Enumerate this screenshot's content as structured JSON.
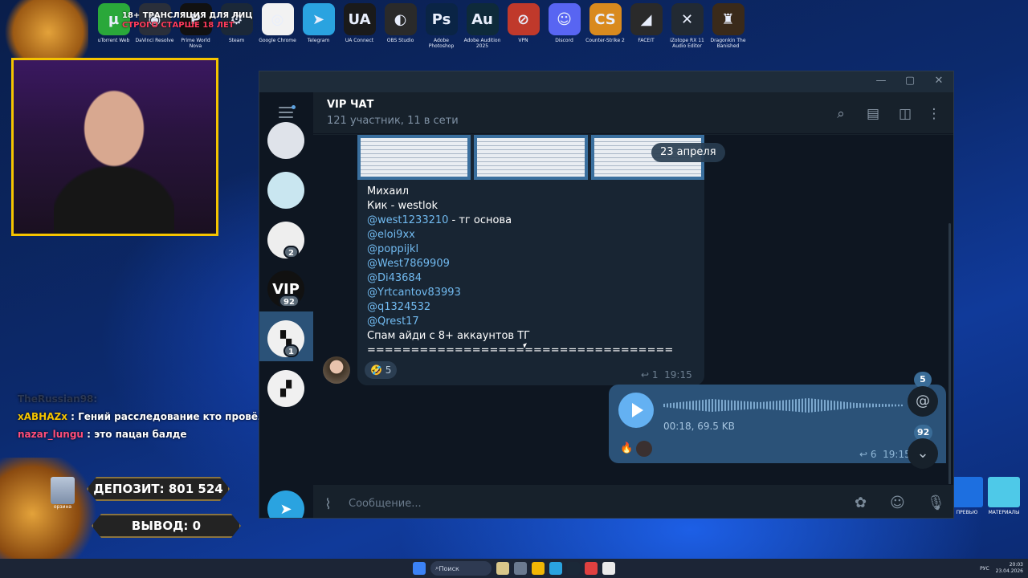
{
  "desktop": {
    "stream_title": [
      "ТРАНСЛЯЦИЯ ДЛЯ ЛИЦ",
      "СТРОГО СТАРШЕ 18 ЛЕТ"
    ],
    "age_rating": "18+",
    "icons": [
      {
        "label": "uTorrent Web",
        "icon": "utorrent-icon",
        "color": "#2aa83a",
        "glyph": "µ"
      },
      {
        "label": "DaVinci Resolve",
        "icon": "davinci-icon",
        "color": "#2a2f3a",
        "glyph": "◉"
      },
      {
        "label": "Prime World Nova",
        "icon": "prime-world-icon",
        "color": "#111111",
        "glyph": "P"
      },
      {
        "label": "Steam",
        "icon": "steam-icon",
        "color": "#1b2838",
        "glyph": "⚙"
      },
      {
        "label": "Google Chrome",
        "icon": "chrome-icon",
        "color": "#f2f2f2",
        "glyph": "◎"
      },
      {
        "label": "Telegram",
        "icon": "telegram-icon",
        "color": "#2aa3e0",
        "glyph": "➤"
      },
      {
        "label": "UA Connect",
        "icon": "ua-connect-icon",
        "color": "#1a1a1a",
        "glyph": "UA"
      },
      {
        "label": "OBS Studio",
        "icon": "obs-icon",
        "color": "#2a2a2a",
        "glyph": "◐"
      },
      {
        "label": "Adobe Photoshop",
        "icon": "photoshop-icon",
        "color": "#0a2445",
        "glyph": "Ps"
      },
      {
        "label": "Adobe Audition 2025",
        "icon": "audition-icon",
        "color": "#0e2a3a",
        "glyph": "Au"
      },
      {
        "label": "VPN",
        "icon": "vpn-icon",
        "color": "#c0392b",
        "glyph": "⊘"
      },
      {
        "label": "Discord",
        "icon": "discord-icon",
        "color": "#5865f2",
        "glyph": "☺"
      },
      {
        "label": "Counter-Strike 2",
        "icon": "cs2-icon",
        "color": "#d98a1e",
        "glyph": "CS"
      },
      {
        "label": "FACEIT",
        "icon": "faceit-icon",
        "color": "#2a2a2a",
        "glyph": "◢"
      },
      {
        "label": "iZotope RX 11 Audio Editor",
        "icon": "izotope-icon",
        "color": "#222a33",
        "glyph": "✕"
      },
      {
        "label": "Dragonkin The Banished",
        "icon": "dragonkin-icon",
        "color": "#3a2a1a",
        "glyph": "♜"
      }
    ],
    "partial_icons": [
      "Topaz Gigapixel AI"
    ],
    "bottom_icons": [
      {
        "label": "ПРЕВЬЮ",
        "color": "#1d6fe0"
      },
      {
        "label": "МАТЕРИАЛЫ",
        "color": "#4ec9e8"
      }
    ],
    "recycle_label": "орзина"
  },
  "stream_chat": {
    "faded": "TheRussian98:",
    "messages": [
      {
        "user": "xABHAZx",
        "text": " : Гений расследование кто провёл"
      },
      {
        "user": "nazar_lungu",
        "text": " : это пацан балде"
      }
    ]
  },
  "overlay": {
    "deposit": "ДЕПОЗИТ:  801 524",
    "withdraw": "ВЫВОД:  0"
  },
  "telegram": {
    "chat_title": "VIP ЧАТ",
    "chat_subtitle": "121 участник, 11 в сети",
    "date_pill": "23 апреля",
    "sidebar": [
      {
        "name": "avatar-1",
        "color": "#dfe3ea",
        "text": "",
        "badge": ""
      },
      {
        "name": "avatar-2",
        "color": "#c9e6f0",
        "text": "",
        "badge": ""
      },
      {
        "name": "avatar-3",
        "color": "#eeeeee",
        "text": "",
        "badge": "2"
      },
      {
        "name": "avatar-vip",
        "color": "#111111",
        "text": "VIP",
        "badge": "92"
      },
      {
        "name": "avatar-5",
        "color": "#f0f0f0",
        "text": "▚",
        "badge": "1"
      },
      {
        "name": "avatar-6",
        "color": "#f0f0f0",
        "text": "▞",
        "badge": ""
      }
    ],
    "message": {
      "lines": [
        {
          "text": "Михаил",
          "link": false
        },
        {
          "text": "Кик - westlok",
          "link": false
        },
        {
          "text": "@west1233210",
          "link": true,
          "suffix": " - тг основа"
        },
        {
          "text": "@eloi9xx",
          "link": true
        },
        {
          "text": "@poppijkl",
          "link": true
        },
        {
          "text": "@West7869909",
          "link": true
        },
        {
          "text": "@Di43684",
          "link": true
        },
        {
          "text": "@Yrtcantov83993",
          "link": true
        },
        {
          "text": "@q1324532",
          "link": true
        },
        {
          "text": "@Qrest17",
          "link": true
        },
        {
          "text": "Спам айди с 8+ аккаунтов ТГ",
          "link": false
        },
        {
          "text": "===================================",
          "link": false
        }
      ],
      "reaction": "🤣 5",
      "replies": "1",
      "time": "19:15"
    },
    "voice": {
      "meta": "00:18, 69.5 KB",
      "reactions": "🔥",
      "replies": "6",
      "time": "19:15"
    },
    "floating": {
      "mentions_badge": "5",
      "unread_badge": "92"
    },
    "composer_placeholder": "Сообщение..."
  },
  "taskbar": {
    "search": "Поиск",
    "lang": "РУС",
    "time": "20:03",
    "date": "23.04.2026"
  }
}
